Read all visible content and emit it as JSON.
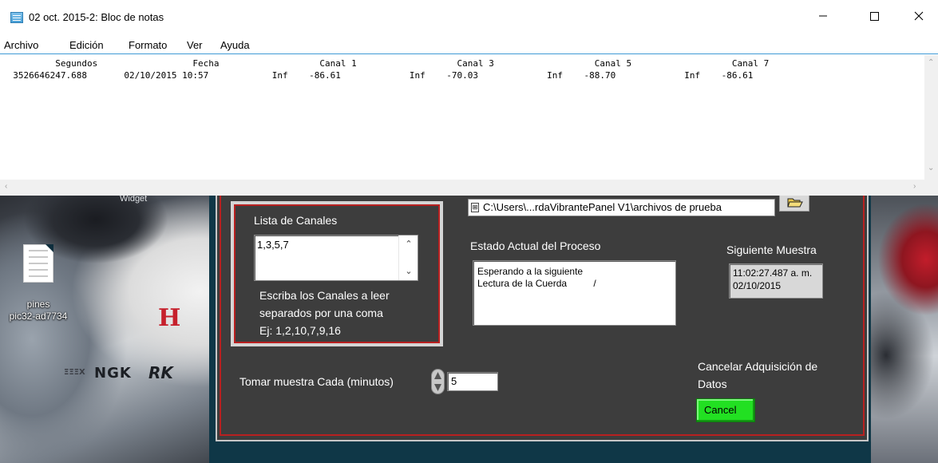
{
  "notepad": {
    "title": "02 oct. 2015-2: Bloc de notas",
    "menu": [
      "Archivo",
      "Edición",
      "Formato",
      "Ver",
      "Ayuda"
    ],
    "header_line": "          Segundos                  Fecha                   Canal 1                   Canal 3                   Canal 5                   Canal 7",
    "data_line": "  3526646247.688       02/10/2015 10:57            Inf    -86.61             Inf    -70.03             Inf    -88.70             Inf    -86.61"
  },
  "desktop": {
    "file_name_line1": "pines",
    "file_name_line2": "pic32-ad7734",
    "wallpaper_text_top": "Widget",
    "wallpaper_logo_h": "H",
    "wallpaper_logo_ngk": "NGK",
    "wallpaper_logo_rk": "RK",
    "wallpaper_logo_small": "ΞΞΞX"
  },
  "labview": {
    "path_value": "C:\\Users\\...rdaVibrantePanel V1\\archivos de prueba",
    "lista_label": "Lista de Canales",
    "lista_value": "1,3,5,7",
    "lista_help_1": "Escriba los Canales a leer",
    "lista_help_2": "separados por una coma",
    "lista_help_3": "Ej: 1,2,10,7,9,16",
    "estado_label": "Estado Actual del Proceso",
    "estado_line1": "Esperando a la siguiente",
    "estado_line2": "Lectura de la Cuerda          /",
    "siguiente_label": "Siguiente Muestra",
    "siguiente_line1": "11:02:27.487 a. m.",
    "siguiente_line2": "02/10/2015",
    "intervalo_label": "Tomar muestra Cada (minutos)",
    "intervalo_value": "5",
    "cancelar_label_1": "Cancelar Adquisición de",
    "cancelar_label_2": "Datos",
    "cancel_button": "Cancel"
  },
  "colors": {
    "panel_bg": "#3d3d3d",
    "panel_border_red": "#b82020",
    "cancel_green": "#22e022",
    "accent_blue": "#3f9ad6"
  }
}
